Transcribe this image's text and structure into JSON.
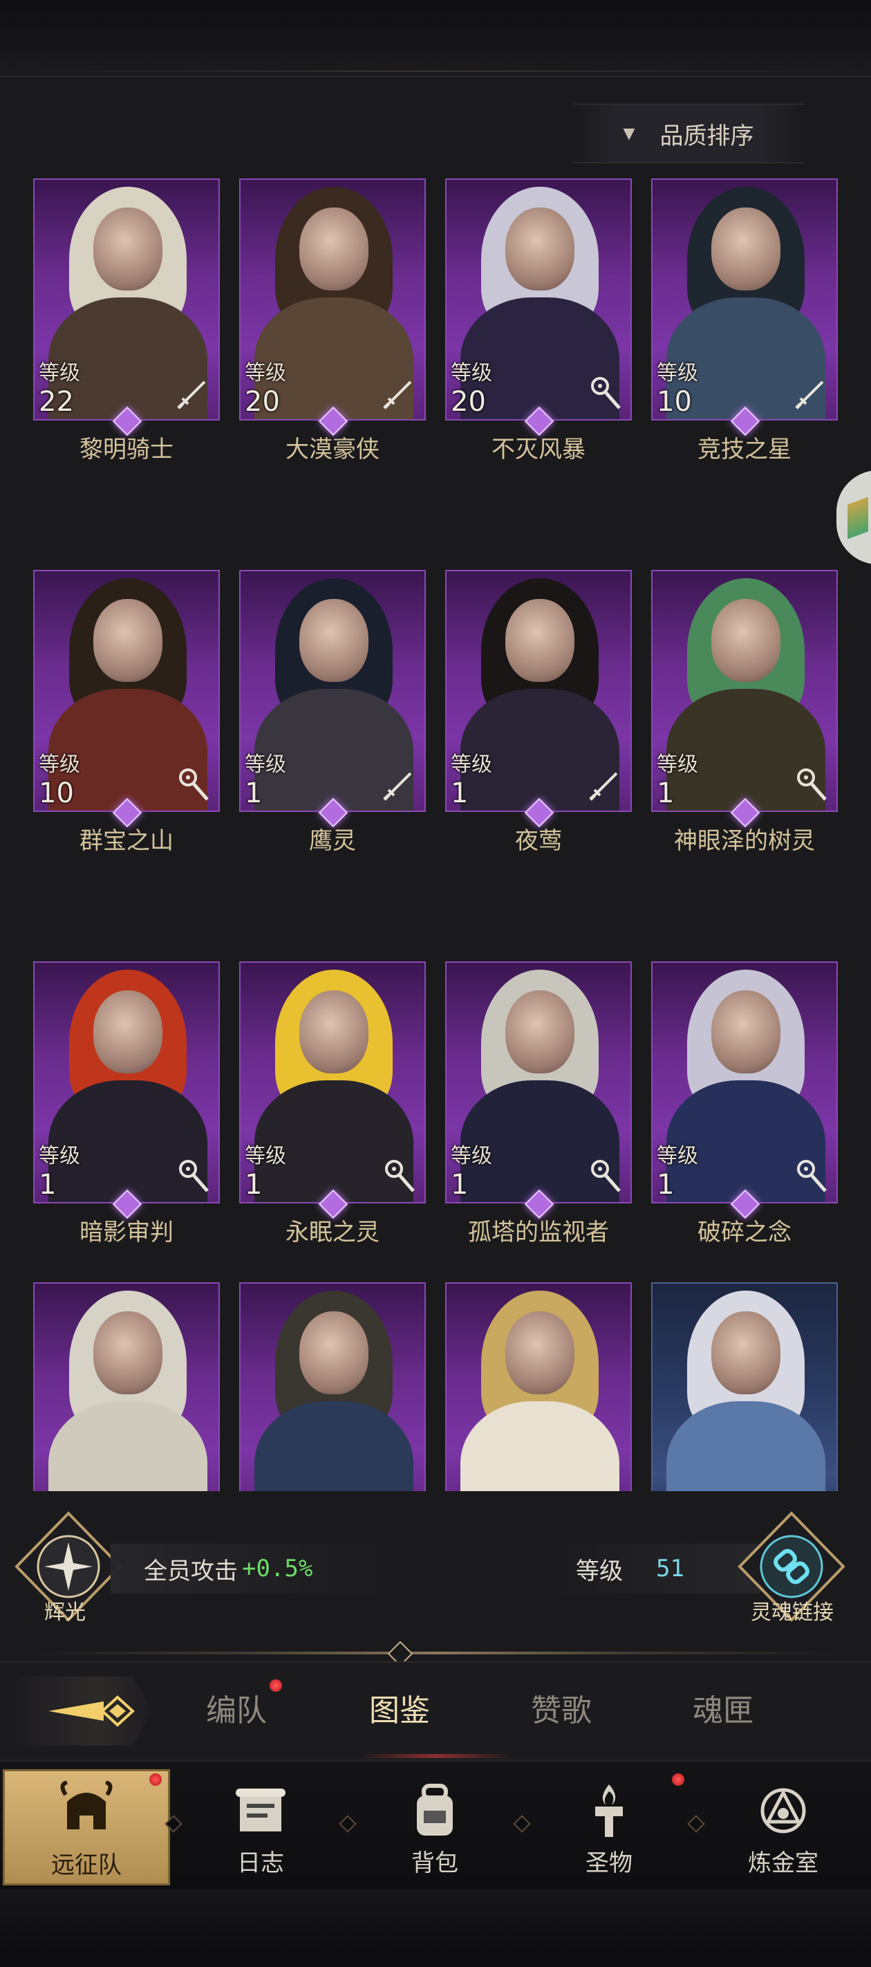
{
  "sort": {
    "label": "品质排序",
    "arrow": "▼"
  },
  "level_label": "等级",
  "heroes": [
    {
      "name": "黎明骑士",
      "level": "22",
      "class_icon": "sword-icon",
      "hair": "#d8d2c2",
      "outfit": "#4a3a30"
    },
    {
      "name": "大漠豪侠",
      "level": "20",
      "class_icon": "sword-icon",
      "hair": "#3a2a20",
      "outfit": "#5a4636"
    },
    {
      "name": "不灭风暴",
      "level": "20",
      "class_icon": "staff-icon",
      "hair": "#c9c6d6",
      "outfit": "#2a2440"
    },
    {
      "name": "竞技之星",
      "level": "10",
      "class_icon": "sword-icon",
      "hair": "#1e2630",
      "outfit": "#3a4d66"
    },
    {
      "name": "群宝之山",
      "level": "10",
      "class_icon": "staff-icon",
      "hair": "#2a2018",
      "outfit": "#6a2a24"
    },
    {
      "name": "鹰灵",
      "level": "1",
      "class_icon": "sword-icon",
      "hair": "#1a1f2e",
      "outfit": "#3a3640"
    },
    {
      "name": "夜莺",
      "level": "1",
      "class_icon": "sword-icon",
      "hair": "#1a1616",
      "outfit": "#2a2436"
    },
    {
      "name": "神眼泽的树灵",
      "level": "1",
      "class_icon": "staff-icon",
      "hair": "#4a8a5a",
      "outfit": "#3a3426"
    },
    {
      "name": "暗影审判",
      "level": "1",
      "class_icon": "staff-icon",
      "hair": "#c0361c",
      "outfit": "#24202c"
    },
    {
      "name": "永眠之灵",
      "level": "1",
      "class_icon": "staff-icon",
      "hair": "#e8c030",
      "outfit": "#26242a"
    },
    {
      "name": "孤塔的监视者",
      "level": "1",
      "class_icon": "staff-icon",
      "hair": "#c8c6bc",
      "outfit": "#22223a"
    },
    {
      "name": "破碎之念",
      "level": "1",
      "class_icon": "staff-icon",
      "hair": "#c6c4d4",
      "outfit": "#26305a"
    },
    {
      "name": "",
      "level": "",
      "class_icon": "",
      "hair": "#d6d2c6",
      "outfit": "#cfcabc"
    },
    {
      "name": "",
      "level": "",
      "class_icon": "",
      "hair": "#3a3630",
      "outfit": "#2c3a5a"
    },
    {
      "name": "",
      "level": "",
      "class_icon": "",
      "hair": "#c9a860",
      "outfit": "#e8e0d0"
    },
    {
      "name": "",
      "level": "",
      "class_icon": "",
      "hair": "#d8d8e2",
      "outfit": "#5a78a8",
      "blue": true
    }
  ],
  "stats": {
    "radiance_label": "辉光",
    "attack_text": "全员攻击",
    "attack_bonus": "+0.5%",
    "level_text": "等级",
    "level_value": "51",
    "soul_link_label": "灵魂链接"
  },
  "subtabs": [
    {
      "label": "编队",
      "badge": true,
      "active": false
    },
    {
      "label": "图鉴",
      "badge": false,
      "active": true
    },
    {
      "label": "赞歌",
      "badge": false,
      "active": false
    },
    {
      "label": "魂匣",
      "badge": false,
      "active": false
    }
  ],
  "nav": [
    {
      "label": "远征队",
      "icon": "helmet-icon",
      "active": true,
      "badge": true
    },
    {
      "label": "日志",
      "icon": "scroll-icon",
      "active": false,
      "badge": false
    },
    {
      "label": "背包",
      "icon": "backpack-icon",
      "active": false,
      "badge": false
    },
    {
      "label": "圣物",
      "icon": "torch-icon",
      "active": false,
      "badge": true
    },
    {
      "label": "炼金室",
      "icon": "alchemy-icon",
      "active": false,
      "badge": false
    }
  ],
  "colors": {
    "accent_purple": "#7b35a6",
    "bonus_green": "#6ddc6a",
    "level_cyan": "#7ad8e8",
    "badge_red": "#e02020"
  }
}
